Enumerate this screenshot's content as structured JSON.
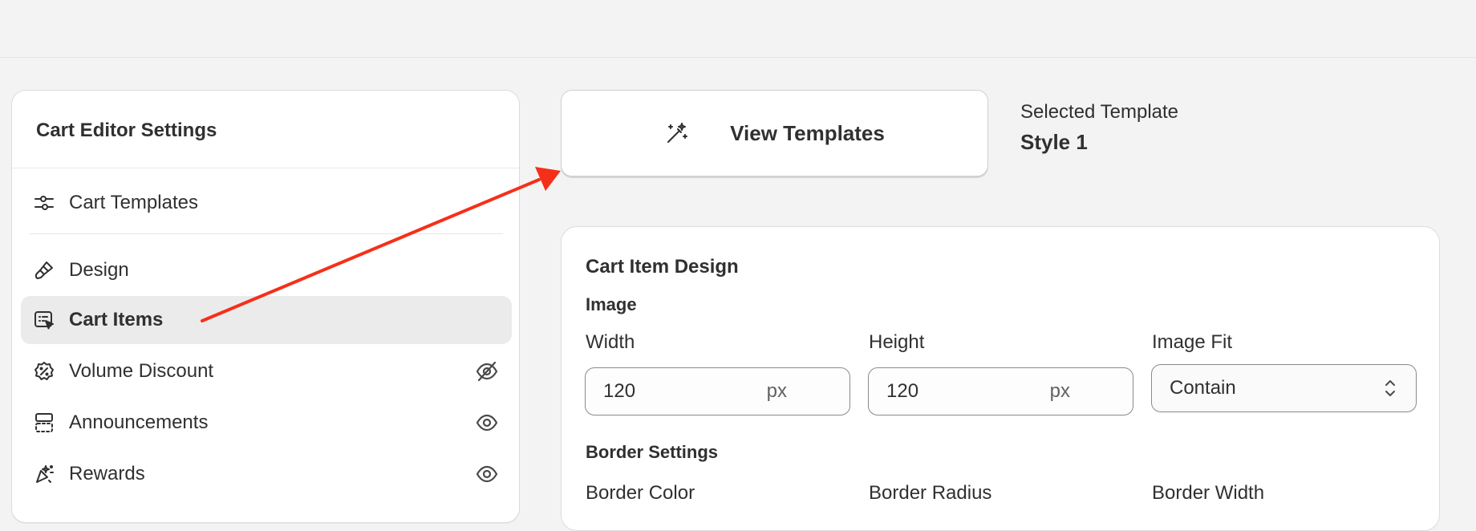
{
  "sidebar": {
    "title": "Cart Editor Settings",
    "items": [
      {
        "label": "Cart Templates",
        "icon": "sliders-icon",
        "active": false
      },
      {
        "label": "Design",
        "icon": "brush-icon",
        "active": false
      },
      {
        "label": "Cart Items",
        "icon": "cart-item-cursor-icon",
        "active": true
      },
      {
        "label": "Volume Discount",
        "icon": "discount-badge-icon",
        "visibility": "hidden",
        "active": false
      },
      {
        "label": "Announcements",
        "icon": "announcement-layout-icon",
        "visibility": "visible",
        "active": false
      },
      {
        "label": "Rewards",
        "icon": "sparkle-confetti-icon",
        "visibility": "visible",
        "active": false
      }
    ]
  },
  "templates": {
    "button_label": "View Templates",
    "button_icon": "magic-wand-icon",
    "selected_label": "Selected Template",
    "selected_value": "Style 1"
  },
  "design": {
    "title": "Cart Item Design",
    "image_heading": "Image",
    "width_label": "Width",
    "width_value": "120",
    "width_unit": "px",
    "height_label": "Height",
    "height_value": "120",
    "height_unit": "px",
    "fit_label": "Image Fit",
    "fit_value": "Contain",
    "border_heading": "Border Settings",
    "border_color_label": "Border Color",
    "border_radius_label": "Border Radius",
    "border_width_label": "Border Width"
  },
  "colors": {
    "annotation_arrow": "#f5301a",
    "active_item_bg": "#ebebeb",
    "background": "#f3f3f3"
  }
}
